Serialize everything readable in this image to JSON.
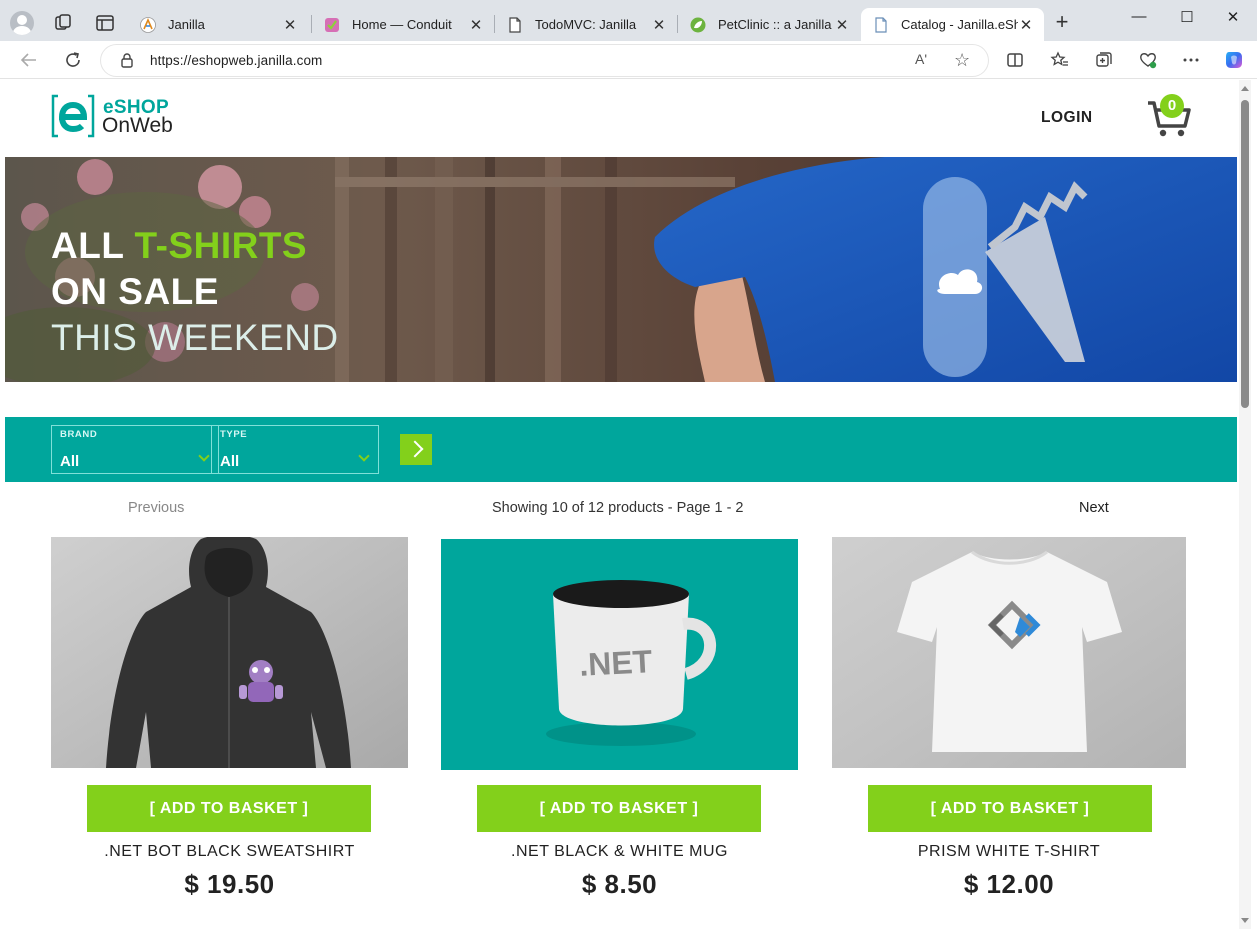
{
  "browser": {
    "tabs": [
      {
        "title": "Janilla",
        "icon": "janilla-favicon"
      },
      {
        "title": "Home — Conduit",
        "icon": "conduit-favicon"
      },
      {
        "title": "TodoMVC: Janilla",
        "icon": "document-favicon"
      },
      {
        "title": "PetClinic :: a Janilla dem",
        "icon": "spring-leaf-favicon"
      },
      {
        "title": "Catalog - Janilla.eShop",
        "icon": "document-favicon",
        "active": true
      }
    ],
    "close_glyph": "✕",
    "new_tab_glyph": "+",
    "window_controls": {
      "minimize": "—",
      "maximize": "☐",
      "close": "✕"
    },
    "url": "https://eshopweb.janilla.com",
    "read_aloud_glyph": "Aʹ",
    "favorite_glyph": "☆"
  },
  "site": {
    "logo": {
      "line1": "eSHOP",
      "line2": "OnWeb"
    },
    "login_label": "LOGIN",
    "cart_count": "0"
  },
  "hero": {
    "line1_white": "ALL ",
    "line1_green": "T-SHIRTS",
    "line2": "ON SALE",
    "line3": "THIS WEEKEND"
  },
  "filters": {
    "brand": {
      "label": "BRAND",
      "value": "All"
    },
    "type": {
      "label": "TYPE",
      "value": "All"
    }
  },
  "pager": {
    "previous": "Previous",
    "info": "Showing 10 of 12 products - Page 1 - 2",
    "next": "Next"
  },
  "products": [
    {
      "name": ".NET BOT BLACK SWEATSHIRT",
      "price": "$ 19.50",
      "button": "[ ADD TO BASKET ]"
    },
    {
      "name": ".NET BLACK & WHITE MUG",
      "price": "$ 8.50",
      "button": "[ ADD TO BASKET ]",
      "mug_text": ".NET"
    },
    {
      "name": "PRISM WHITE T-SHIRT",
      "price": "$ 12.00",
      "button": "[ ADD TO BASKET ]"
    }
  ],
  "colors": {
    "brand_teal": "#00a69c",
    "accent_green": "#83d01b",
    "tabstrip": "#dfe3e8"
  }
}
